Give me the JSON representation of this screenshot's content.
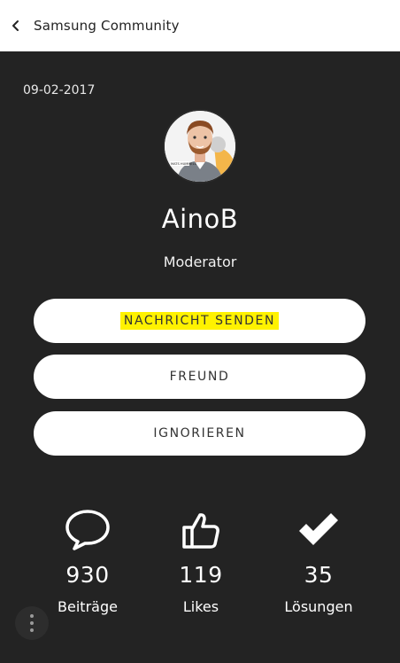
{
  "header": {
    "title": "Samsung Community"
  },
  "profile": {
    "date": "09-02-2017",
    "avatar_caption": "MATS HUMMELS",
    "name": "AinoB",
    "role": "Moderator"
  },
  "actions": {
    "send_message": "NACHRICHT SENDEN",
    "friend": "FREUND",
    "ignore": "IGNORIEREN"
  },
  "stats": [
    {
      "icon": "speech-bubble-icon",
      "value": "930",
      "label": "Beiträge"
    },
    {
      "icon": "thumbs-up-icon",
      "value": "119",
      "label": "Likes"
    },
    {
      "icon": "checkmark-icon",
      "value": "35",
      "label": "Lösungen"
    }
  ],
  "colors": {
    "highlight": "#fff200",
    "background": "#232323"
  }
}
